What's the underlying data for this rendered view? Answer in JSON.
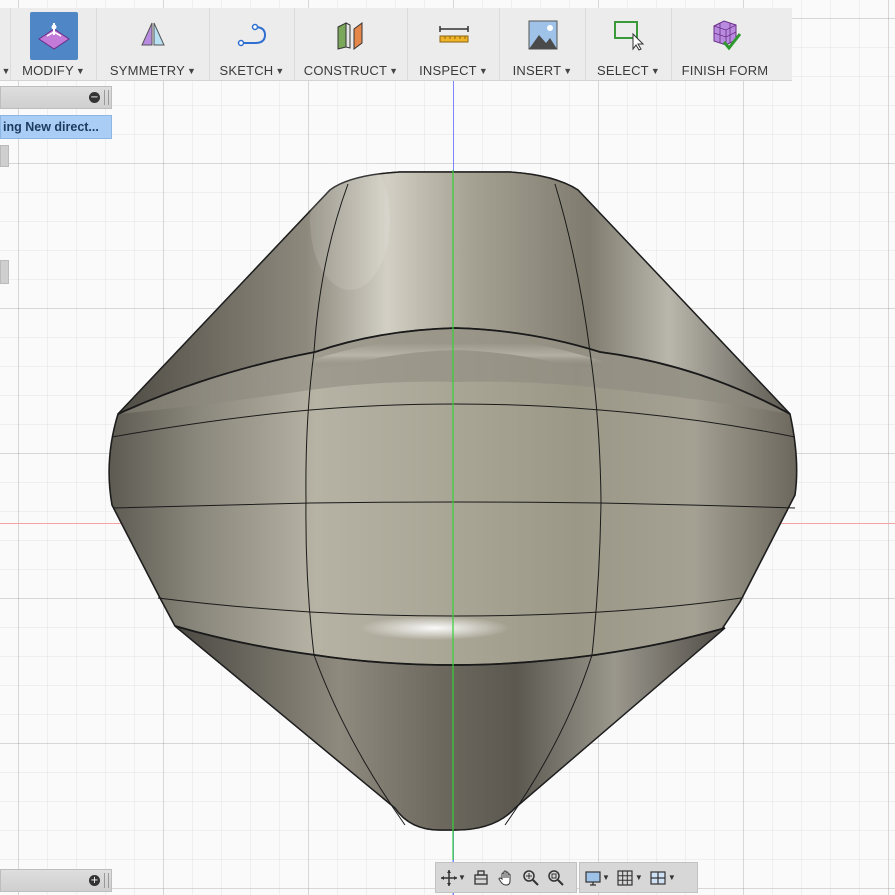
{
  "toolbar": {
    "groups": [
      {
        "id": "modify",
        "label": "MODIFY"
      },
      {
        "id": "symmetry",
        "label": "SYMMETRY"
      },
      {
        "id": "sketch",
        "label": "SKETCH"
      },
      {
        "id": "construct",
        "label": "CONSTRUCT"
      },
      {
        "id": "inspect",
        "label": "INSPECT"
      },
      {
        "id": "insert",
        "label": "INSERT"
      },
      {
        "id": "select",
        "label": "SELECT"
      },
      {
        "id": "finish_form",
        "label": "FINISH FORM"
      }
    ],
    "caret": "▼",
    "active_group": "modify",
    "active_color": "#4f86c6"
  },
  "browser_panel": {
    "collapse_icon": "minus-circle-icon",
    "selected_item": "ing New direct..."
  },
  "bottom_panel": {
    "expand_icon": "plus-circle-icon"
  },
  "navbar": {
    "icons": [
      "orbit-icon",
      "look-at-icon",
      "pan-icon",
      "zoom-window-icon",
      "zoom-fit-icon",
      "display-settings-icon",
      "grid-settings-icon",
      "viewports-icon"
    ]
  },
  "viewport": {
    "grid_color": "#d0d0d0",
    "axis_colors": {
      "vertical_blue": "#7b86ff",
      "vertical_green": "#35d235",
      "horizontal_red": "#f3a3a3"
    },
    "model_color": "#8a8577"
  }
}
